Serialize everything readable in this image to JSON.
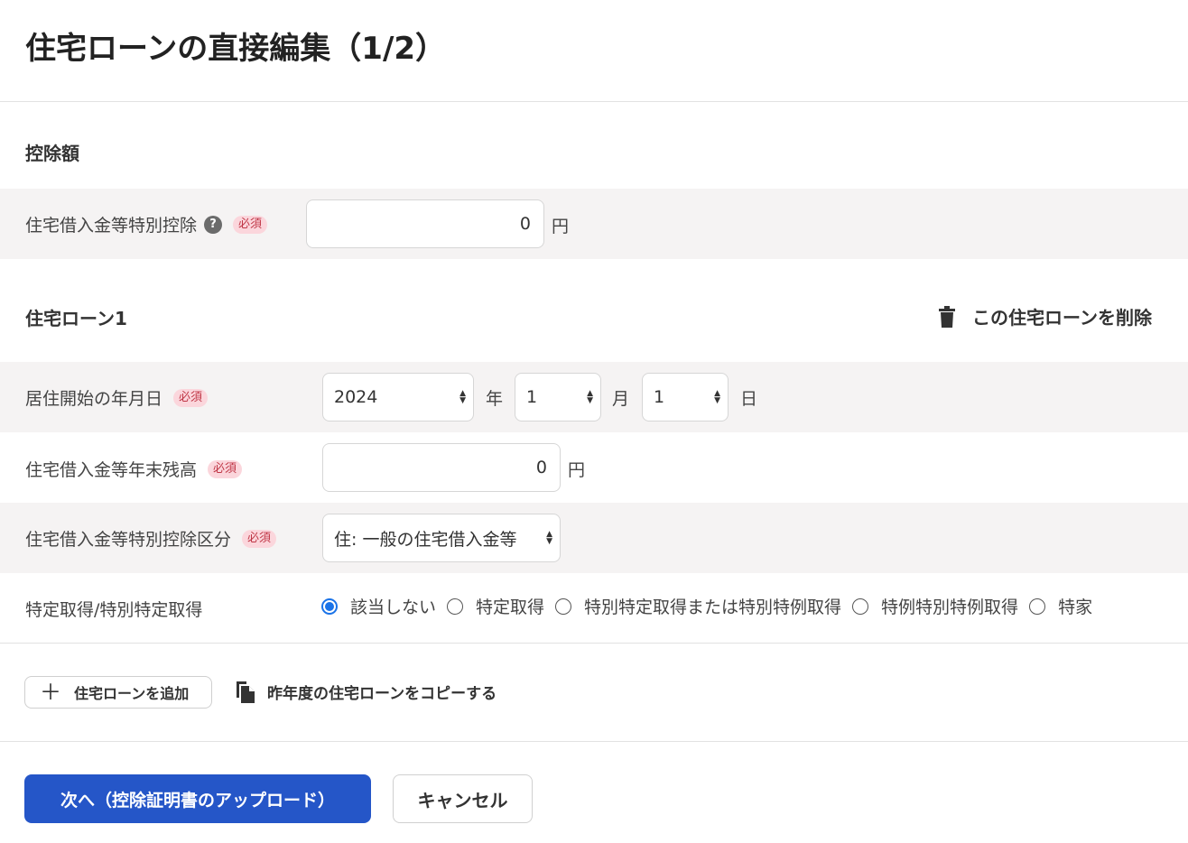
{
  "page": {
    "title": "住宅ローンの直接編集（1/2）"
  },
  "deduction": {
    "heading": "控除額",
    "special_deduction": {
      "label": "住宅借入金等特別控除",
      "help": "?",
      "required": "必須",
      "value": "0",
      "unit": "円"
    }
  },
  "loan": {
    "heading": "住宅ローン1",
    "delete_label": "この住宅ローンを削除",
    "move_in_date": {
      "label": "居住開始の年月日",
      "required": "必須",
      "year": "2024",
      "year_unit": "年",
      "month": "1",
      "month_unit": "月",
      "day": "1",
      "day_unit": "日"
    },
    "year_end_balance": {
      "label": "住宅借入金等年末残高",
      "required": "必須",
      "value": "0",
      "unit": "円"
    },
    "deduction_category": {
      "label": "住宅借入金等特別控除区分",
      "required": "必須",
      "value": "住: 一般の住宅借入金等"
    },
    "acquisition_type": {
      "label": "特定取得/特別特定取得",
      "options": [
        {
          "label": "該当しない",
          "checked": true
        },
        {
          "label": "特定取得",
          "checked": false
        },
        {
          "label": "特別特定取得または特別特例取得",
          "checked": false
        },
        {
          "label": "特例特別特例取得",
          "checked": false
        },
        {
          "label": "特家",
          "checked": false
        }
      ]
    }
  },
  "actions": {
    "add_loan": "住宅ローンを追加",
    "copy_previous": "昨年度の住宅ローンをコピーする",
    "next": "次へ（控除証明書のアップロード）",
    "cancel": "キャンセル"
  },
  "colors": {
    "primary": "#2556c8",
    "required_badge_bg": "#fbd6dc",
    "required_badge_text": "#c03747",
    "radio_checked": "#1a73e8",
    "row_gray": "#f5f3f3"
  },
  "icons": {
    "help": "question-circle-icon",
    "delete": "trash-icon",
    "add": "plus-icon",
    "copy": "copy-document-icon",
    "select": "updown-arrows-icon"
  }
}
